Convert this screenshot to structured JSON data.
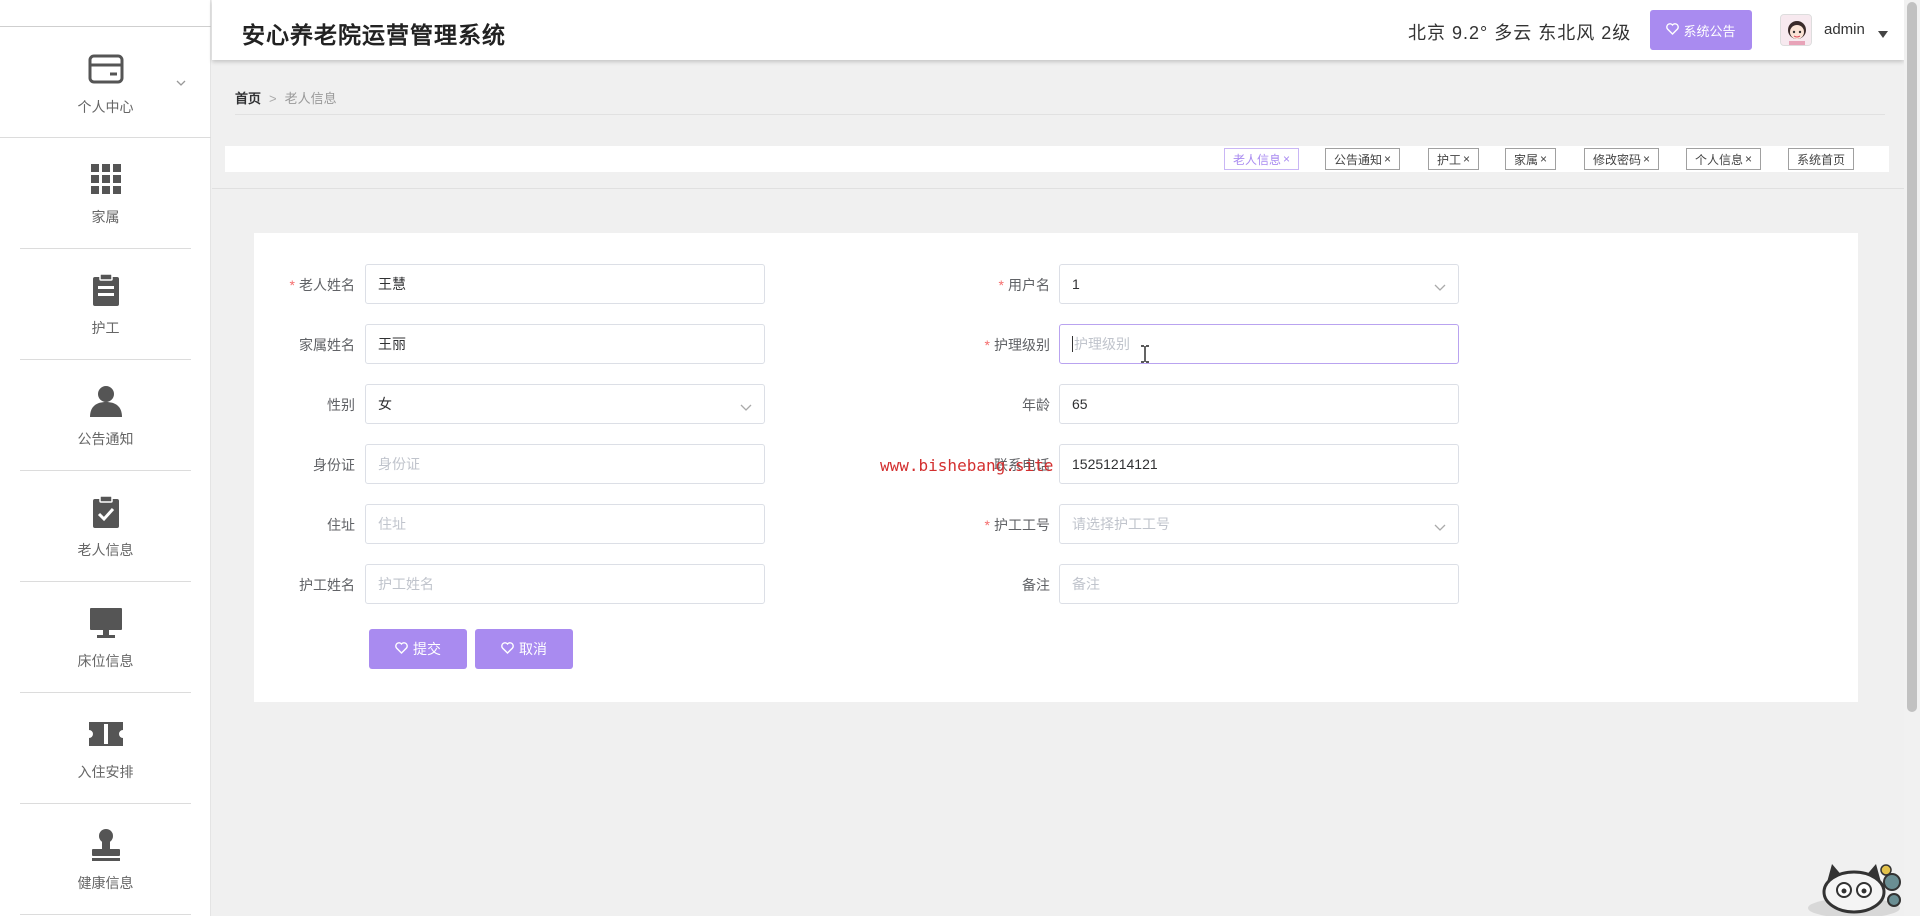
{
  "app": {
    "title": "安心养老院运营管理系统",
    "weather": "北京  9.2°  多云  东北风  2级",
    "notice_button": "系统公告",
    "user": "admin"
  },
  "sidebar": {
    "items": [
      {
        "label": "个人中心",
        "icon": "credit-card-icon"
      },
      {
        "label": "家属",
        "icon": "grid-icon"
      },
      {
        "label": "护工",
        "icon": "clipboard-icon"
      },
      {
        "label": "公告通知",
        "icon": "user-icon"
      },
      {
        "label": "老人信息",
        "icon": "clipboard-check-icon"
      },
      {
        "label": "床位信息",
        "icon": "monitor-icon"
      },
      {
        "label": "入住安排",
        "icon": "ticket-icon"
      },
      {
        "label": "健康信息",
        "icon": "stamp-icon"
      }
    ]
  },
  "breadcrumb": {
    "home": "首页",
    "separator": ">",
    "current": "老人信息"
  },
  "tags": [
    {
      "label": "老人信息",
      "active": true
    },
    {
      "label": "公告通知"
    },
    {
      "label": "护工"
    },
    {
      "label": "家属"
    },
    {
      "label": "修改密码"
    },
    {
      "label": "个人信息"
    },
    {
      "label": "系统首页"
    }
  ],
  "form": {
    "elder_name": {
      "label": "老人姓名",
      "value": "王慧",
      "required": true
    },
    "family_name": {
      "label": "家属姓名",
      "value": "王丽"
    },
    "gender": {
      "label": "性别",
      "value": "女"
    },
    "id_card": {
      "label": "身份证",
      "placeholder": "身份证"
    },
    "address": {
      "label": "住址",
      "placeholder": "住址"
    },
    "caregiver_name": {
      "label": "护工姓名",
      "placeholder": "护工姓名"
    },
    "username": {
      "label": "用户名",
      "value": "1",
      "required": true
    },
    "care_level": {
      "label": "护理级别",
      "placeholder": "护理级别",
      "required": true
    },
    "age": {
      "label": "年龄",
      "value": "65"
    },
    "phone": {
      "label": "联系电话",
      "value": "15251214121"
    },
    "caregiver_id": {
      "label": "护工工号",
      "placeholder": "请选择护工工号",
      "required": true
    },
    "remark": {
      "label": "备注",
      "placeholder": "备注"
    },
    "submit": "提交",
    "cancel": "取消"
  },
  "watermark": "www.bishebang.site",
  "colors": {
    "accent": "#a98bf0",
    "required": "#f56c6c",
    "watermark": "#d32f2f"
  }
}
